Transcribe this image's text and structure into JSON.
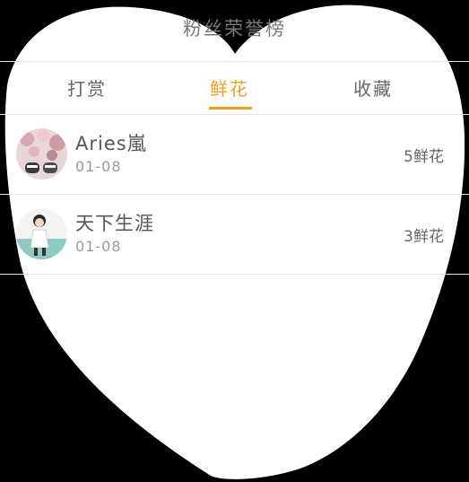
{
  "page_title": "粉丝荣誉榜",
  "tabs": [
    {
      "label": "打赏",
      "active": false
    },
    {
      "label": "鲜花",
      "active": true
    },
    {
      "label": "收藏",
      "active": false
    }
  ],
  "colors": {
    "accent": "#f0a020",
    "background": "#ffffff",
    "text": "#555555",
    "muted": "#9a9a9a"
  },
  "fans": [
    {
      "name": "Aries嵐",
      "date": "01-08",
      "count": "5鲜花",
      "avatar_icon": "avatar-cherry-blossom-sneakers-icon"
    },
    {
      "name": "天下生涯",
      "date": "01-08",
      "count": "3鲜花",
      "avatar_icon": "avatar-girl-icon"
    }
  ]
}
